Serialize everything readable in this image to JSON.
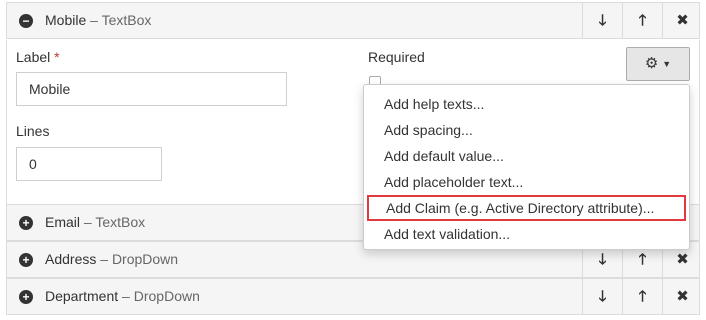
{
  "rows": [
    {
      "title": "Mobile",
      "sep": " – ",
      "type": "TextBox",
      "expanded": true
    },
    {
      "title": "Email",
      "sep": " – ",
      "type": "TextBox"
    },
    {
      "title": "Address",
      "sep": " – ",
      "type": "DropDown"
    },
    {
      "title": "Department",
      "sep": " – ",
      "type": "DropDown"
    }
  ],
  "icons": {
    "collapse": "minus-circle-icon",
    "expand": "plus-circle-icon",
    "down": "arrow-down-icon",
    "up": "arrow-up-icon",
    "delete": "close-icon",
    "settings": "gear-icon"
  },
  "glyphs": {
    "minus": "−",
    "plus": "+",
    "down": "🡓",
    "up": "🡑",
    "close": "✖",
    "gear": "⚙",
    "caret": "▼"
  },
  "form": {
    "label_label": "Label",
    "required_mark": "*",
    "label_value": "Mobile",
    "required_label": "Required",
    "required_checked": false,
    "lines_label": "Lines",
    "lines_value": "0"
  },
  "dropdown": {
    "items": [
      "Add help texts...",
      "Add spacing...",
      "Add default value...",
      "Add placeholder text...",
      "Add Claim (e.g. Active Directory attribute)...",
      "Add text validation..."
    ],
    "highlighted_index": 4,
    "highlight_color": "#e0393e"
  }
}
